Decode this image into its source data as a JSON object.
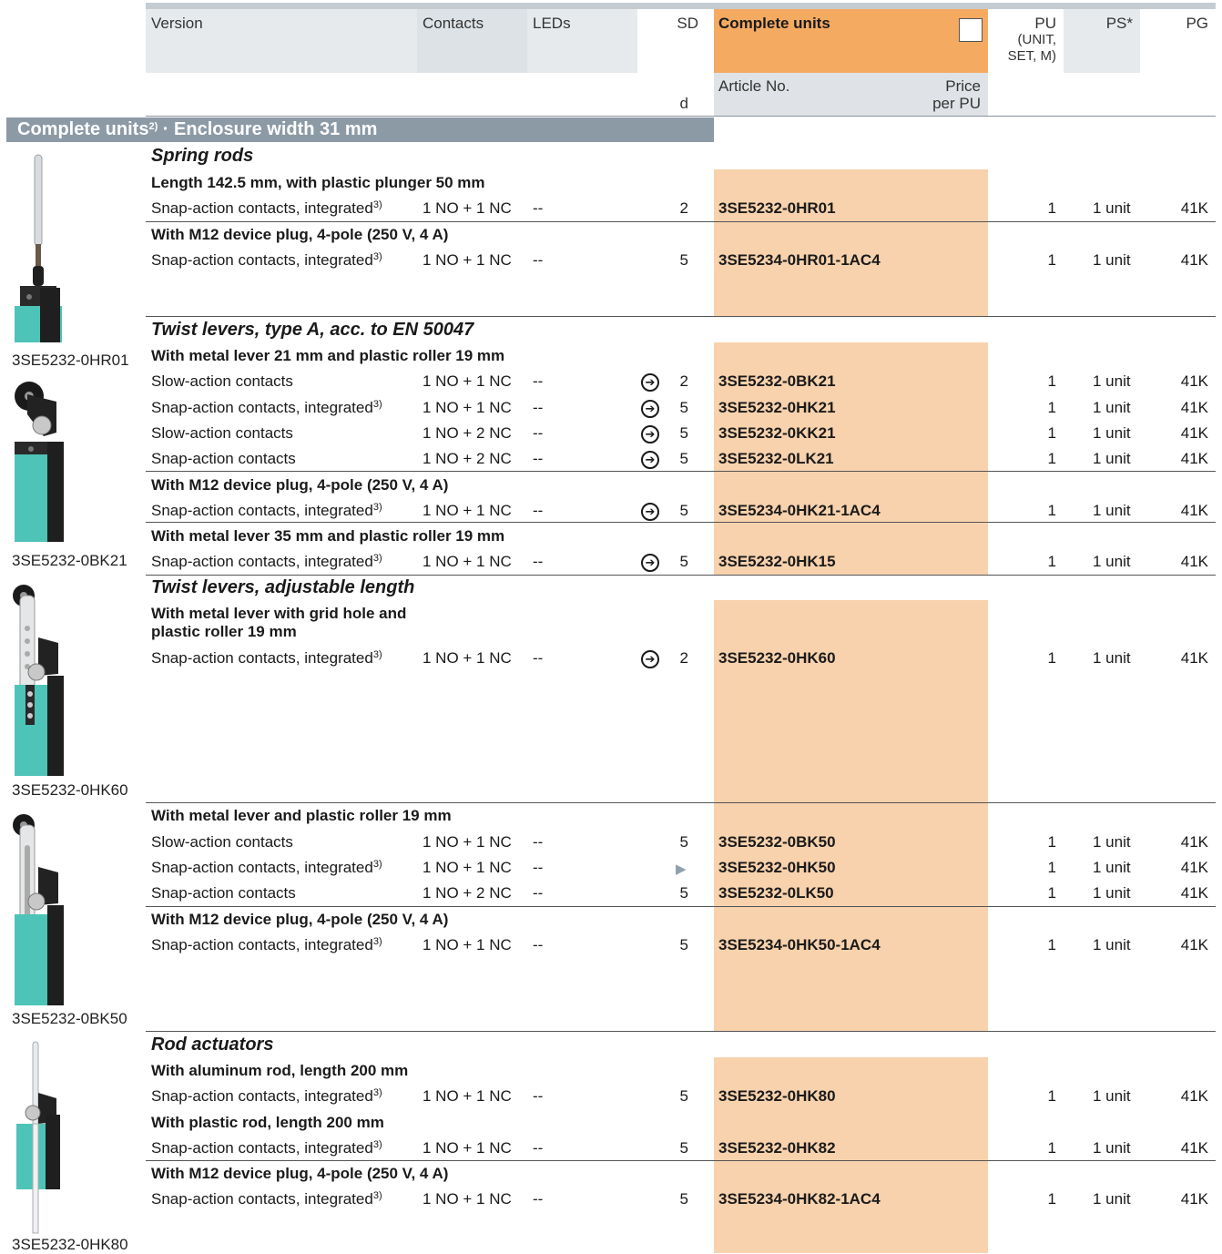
{
  "header": {
    "version": "Version",
    "contacts": "Contacts",
    "leds": "LEDs",
    "sd": "SD",
    "sd_unit": "d",
    "complete_units": "Complete units",
    "article_no": "Article No.",
    "price": "Price",
    "per_pu": "per PU",
    "pu": "PU",
    "pu_sub1": "(UNIT,",
    "pu_sub2": "SET, M)",
    "ps": "PS*",
    "pg": "PG"
  },
  "section": {
    "title_a": "Complete units",
    "title_sup": "2)",
    "title_b": " · Enclosure width 31 mm"
  },
  "images": [
    {
      "caption": "3SE5232-0HR01"
    },
    {
      "caption": "3SE5232-0BK21"
    },
    {
      "caption": "3SE5232-0HK60"
    },
    {
      "caption": "3SE5232-0BK50"
    },
    {
      "caption": "3SE5232-0HK80"
    }
  ],
  "groups": [
    {
      "heading": "Spring rods"
    },
    {
      "heading": "Twist levers, type A, acc. to EN 50047"
    },
    {
      "heading": "Twist levers, adjustable length"
    },
    {
      "heading": "Rod actuators"
    }
  ],
  "subheads": [
    "Length 142.5 mm, with plastic plunger 50 mm",
    "With M12 device plug, 4-pole (250 V, 4 A)",
    "With metal lever 21 mm and plastic roller 19 mm",
    "With M12 device plug, 4-pole (250 V, 4 A)",
    "With metal lever 35 mm and plastic roller 19 mm",
    "With metal lever with grid hole and",
    "plastic roller 19 mm",
    "With metal lever and plastic roller 19 mm",
    "With M12 device plug, 4-pole (250 V, 4 A)",
    "With aluminum rod, length 200 mm",
    "With plastic rod, length 200 mm",
    "With M12 device plug, 4-pole (250 V, 4 A)"
  ],
  "rows": [
    {
      "version": "Snap-action contacts, integrated",
      "sup": "3)",
      "contacts": "1 NO + 1 NC",
      "leds": "--",
      "sd": "2",
      "article": "3SE5232-0HR01",
      "pu": "1",
      "ps": "1 unit",
      "pg": "41K"
    },
    {
      "version": "Snap-action contacts, integrated",
      "sup": "3)",
      "contacts": "1 NO + 1 NC",
      "leds": "--",
      "sd": "5",
      "article": "3SE5234-0HR01-1AC4",
      "pu": "1",
      "ps": "1 unit",
      "pg": "41K"
    },
    {
      "version": "Slow-action contacts",
      "sup": "",
      "contacts": "1 NO + 1 NC",
      "leds": "--",
      "sd": "2",
      "article": "3SE5232-0BK21",
      "pu": "1",
      "ps": "1 unit",
      "pg": "41K"
    },
    {
      "version": "Snap-action contacts, integrated",
      "sup": "3)",
      "contacts": "1 NO + 1 NC",
      "leds": "--",
      "sd": "5",
      "article": "3SE5232-0HK21",
      "pu": "1",
      "ps": "1 unit",
      "pg": "41K"
    },
    {
      "version": "Slow-action contacts",
      "sup": "",
      "contacts": "1 NO + 2 NC",
      "leds": "--",
      "sd": "5",
      "article": "3SE5232-0KK21",
      "pu": "1",
      "ps": "1 unit",
      "pg": "41K"
    },
    {
      "version": "Snap-action contacts",
      "sup": "",
      "contacts": "1 NO + 2 NC",
      "leds": "--",
      "sd": "5",
      "article": "3SE5232-0LK21",
      "pu": "1",
      "ps": "1 unit",
      "pg": "41K"
    },
    {
      "version": "Snap-action contacts, integrated",
      "sup": "3)",
      "contacts": "1 NO + 1 NC",
      "leds": "--",
      "sd": "5",
      "article": "3SE5234-0HK21-1AC4",
      "pu": "1",
      "ps": "1 unit",
      "pg": "41K"
    },
    {
      "version": "Snap-action contacts, integrated",
      "sup": "3)",
      "contacts": "1 NO + 1 NC",
      "leds": "--",
      "sd": "5",
      "article": "3SE5232-0HK15",
      "pu": "1",
      "ps": "1 unit",
      "pg": "41K"
    },
    {
      "version": "Snap-action contacts, integrated",
      "sup": "3)",
      "contacts": "1 NO + 1 NC",
      "leds": "--",
      "sd": "2",
      "article": "3SE5232-0HK60",
      "pu": "1",
      "ps": "1 unit",
      "pg": "41K"
    },
    {
      "version": "Slow-action contacts",
      "sup": "",
      "contacts": "1 NO + 1 NC",
      "leds": "--",
      "sd": "5",
      "article": "3SE5232-0BK50",
      "pu": "1",
      "ps": "1 unit",
      "pg": "41K"
    },
    {
      "version": "Snap-action contacts, integrated",
      "sup": "3)",
      "contacts": "1 NO + 1 NC",
      "leds": "--",
      "sd": "",
      "article": "3SE5232-0HK50",
      "pu": "1",
      "ps": "1 unit",
      "pg": "41K"
    },
    {
      "version": "Snap-action contacts",
      "sup": "",
      "contacts": "1 NO + 2 NC",
      "leds": "--",
      "sd": "5",
      "article": "3SE5232-0LK50",
      "pu": "1",
      "ps": "1 unit",
      "pg": "41K"
    },
    {
      "version": "Snap-action contacts, integrated",
      "sup": "3)",
      "contacts": "1 NO + 1 NC",
      "leds": "--",
      "sd": "5",
      "article": "3SE5234-0HK50-1AC4",
      "pu": "1",
      "ps": "1 unit",
      "pg": "41K"
    },
    {
      "version": "Snap-action contacts, integrated",
      "sup": "3)",
      "contacts": "1 NO + 1 NC",
      "leds": "--",
      "sd": "5",
      "article": "3SE5232-0HK80",
      "pu": "1",
      "ps": "1 unit",
      "pg": "41K"
    },
    {
      "version": "Snap-action contacts, integrated",
      "sup": "3)",
      "contacts": "1 NO + 1 NC",
      "leds": "--",
      "sd": "5",
      "article": "3SE5232-0HK82",
      "pu": "1",
      "ps": "1 unit",
      "pg": "41K"
    },
    {
      "version": "Snap-action contacts, integrated",
      "sup": "3)",
      "contacts": "1 NO + 1 NC",
      "leds": "--",
      "sd": "5",
      "article": "3SE5234-0HK82-1AC4",
      "pu": "1",
      "ps": "1 unit",
      "pg": "41K"
    }
  ],
  "colors": {
    "orange_header": "#f5aa62",
    "orange_column": "#f8d2ad",
    "section_bar": "#8c9aa6",
    "header_cell": "#e6eaed",
    "device_teal": "#4ec3b8",
    "device_black": "#1f1f1f"
  },
  "icons": {
    "arrow": "circle-arrow-right-icon",
    "preferred": "triangle-right-icon"
  }
}
